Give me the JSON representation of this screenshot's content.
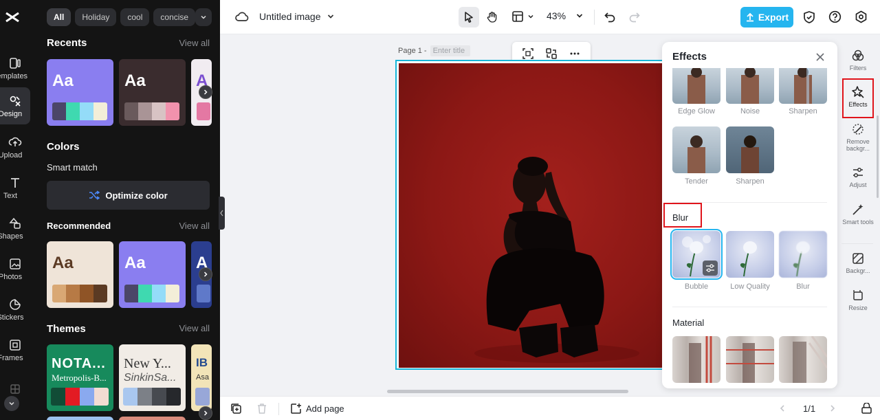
{
  "app": {
    "document_title": "Untitled image",
    "zoom": "43%",
    "export_label": "Export"
  },
  "left_rail": {
    "items": [
      {
        "label": "Templates",
        "icon": "templates-icon"
      },
      {
        "label": "Design",
        "icon": "design-icon",
        "active": true
      },
      {
        "label": "Upload",
        "icon": "upload-icon"
      },
      {
        "label": "Text",
        "icon": "text-icon"
      },
      {
        "label": "Shapes",
        "icon": "shapes-icon"
      },
      {
        "label": "Photos",
        "icon": "photos-icon"
      },
      {
        "label": "Stickers",
        "icon": "stickers-icon"
      },
      {
        "label": "Frames",
        "icon": "frames-icon"
      }
    ]
  },
  "design_panel": {
    "chips": [
      "All",
      "Holiday",
      "cool",
      "concise"
    ],
    "recents": {
      "title": "Recents",
      "link": "View all"
    },
    "colors": {
      "title": "Colors",
      "smart_match": "Smart match",
      "optimize_label": "Optimize color"
    },
    "recommended": {
      "title": "Recommended",
      "link": "View all"
    },
    "themes": {
      "title": "Themes",
      "link": "View all"
    },
    "card_text": "Aa",
    "theme_cards": [
      {
        "line1": "NOTA...",
        "line2": "Metropolis-B..."
      },
      {
        "line1": "New Y...",
        "line2": "SinkinSa..."
      },
      {
        "line1": "IB",
        "line2": "Asa"
      }
    ]
  },
  "canvas": {
    "page_label": "Page 1 -",
    "page_title_placeholder": "Enter title"
  },
  "bottom_bar": {
    "add_page_label": "Add page",
    "page_counter": "1/1"
  },
  "effects_panel": {
    "title": "Effects",
    "row_top": [
      "Edge Glow",
      "Noise",
      "Sharpen"
    ],
    "row_second": [
      "Tender",
      "Sharpen"
    ],
    "blur_section": {
      "title": "Blur",
      "items": [
        "Bubble",
        "Low Quality",
        "Blur"
      ]
    },
    "material_section": {
      "title": "Material"
    }
  },
  "right_tools": {
    "items": [
      {
        "label": "Filters",
        "icon": "filters-icon"
      },
      {
        "label": "Effects",
        "icon": "effects-icon",
        "active": true
      },
      {
        "label": "Remove backgr...",
        "icon": "remove-background-icon"
      },
      {
        "label": "Adjust",
        "icon": "adjust-icon"
      },
      {
        "label": "Smart tools",
        "icon": "smart-tools-icon"
      },
      {
        "label": "Backgr...",
        "icon": "background-icon"
      },
      {
        "label": "Resize",
        "icon": "resize-icon"
      }
    ]
  },
  "colors": {
    "accent": "#25b5ef",
    "selection": "#16b6d9",
    "highlight_red": "#e0141b",
    "photo_background": "#8c1815"
  }
}
